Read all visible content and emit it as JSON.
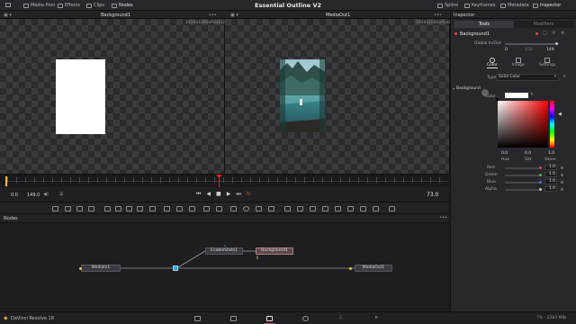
{
  "app": {
    "name": "DaVinci Resolve 18",
    "project_title": "Essential Outline V2"
  },
  "topbar": {
    "left_items": [
      {
        "label": "Media Pool",
        "icon": "media-pool-icon"
      },
      {
        "label": "Effects",
        "icon": "effects-icon"
      },
      {
        "label": "Clips",
        "icon": "clips-icon"
      },
      {
        "label": "Nodes",
        "icon": "nodes-icon"
      }
    ],
    "right_items": [
      {
        "label": "Spline",
        "icon": "spline-icon"
      },
      {
        "label": "Keyframes",
        "icon": "keyframes-icon"
      },
      {
        "label": "Metadata",
        "icon": "metadata-icon"
      },
      {
        "label": "Inspector",
        "icon": "inspector-icon"
      }
    ]
  },
  "viewers": {
    "left": {
      "title": "Background1",
      "resolution": "1920x1080xfloat32"
    },
    "right": {
      "title": "MediaOut1",
      "resolution": "1920x1080xfloat32"
    }
  },
  "transport": {
    "start": "0.0",
    "end": "149.0",
    "current_frame": "73.0"
  },
  "nodes_panel": {
    "title": "Nodes",
    "nodes": [
      "MediaIn1",
      "EnableState1",
      "Background1",
      "MediaOut1"
    ]
  },
  "inspector": {
    "title": "Inspector",
    "tabs": [
      "Tools",
      "Modifiers"
    ],
    "tool_name": "Background1",
    "global_label": "Global In/Out",
    "global_in": "0",
    "global_mid": "150",
    "global_out": "149",
    "subtabs": [
      "Color",
      "Image",
      "Settings"
    ],
    "type_label": "Type",
    "type_value": "Solid Color",
    "section": "Background",
    "color_label": "Color",
    "picker": {
      "values": [
        {
          "label": "Hue",
          "value": "0.0"
        },
        {
          "label": "Sat",
          "value": "0.0"
        },
        {
          "label": "Value",
          "value": "1.0"
        }
      ]
    },
    "channels": [
      {
        "label": "Red",
        "value": "1.0",
        "color": "#e04040"
      },
      {
        "label": "Green",
        "value": "1.0",
        "color": "#40c040"
      },
      {
        "label": "Blue",
        "value": "1.0",
        "color": "#4070e0"
      },
      {
        "label": "Alpha",
        "value": "1.0",
        "color": "#c8c8c8"
      }
    ]
  },
  "status": {
    "memory": "7% - 2283 MB"
  },
  "colors": {
    "accent": "#e64b3c",
    "playhead": "#e02020",
    "highlight": "#f0c030"
  }
}
